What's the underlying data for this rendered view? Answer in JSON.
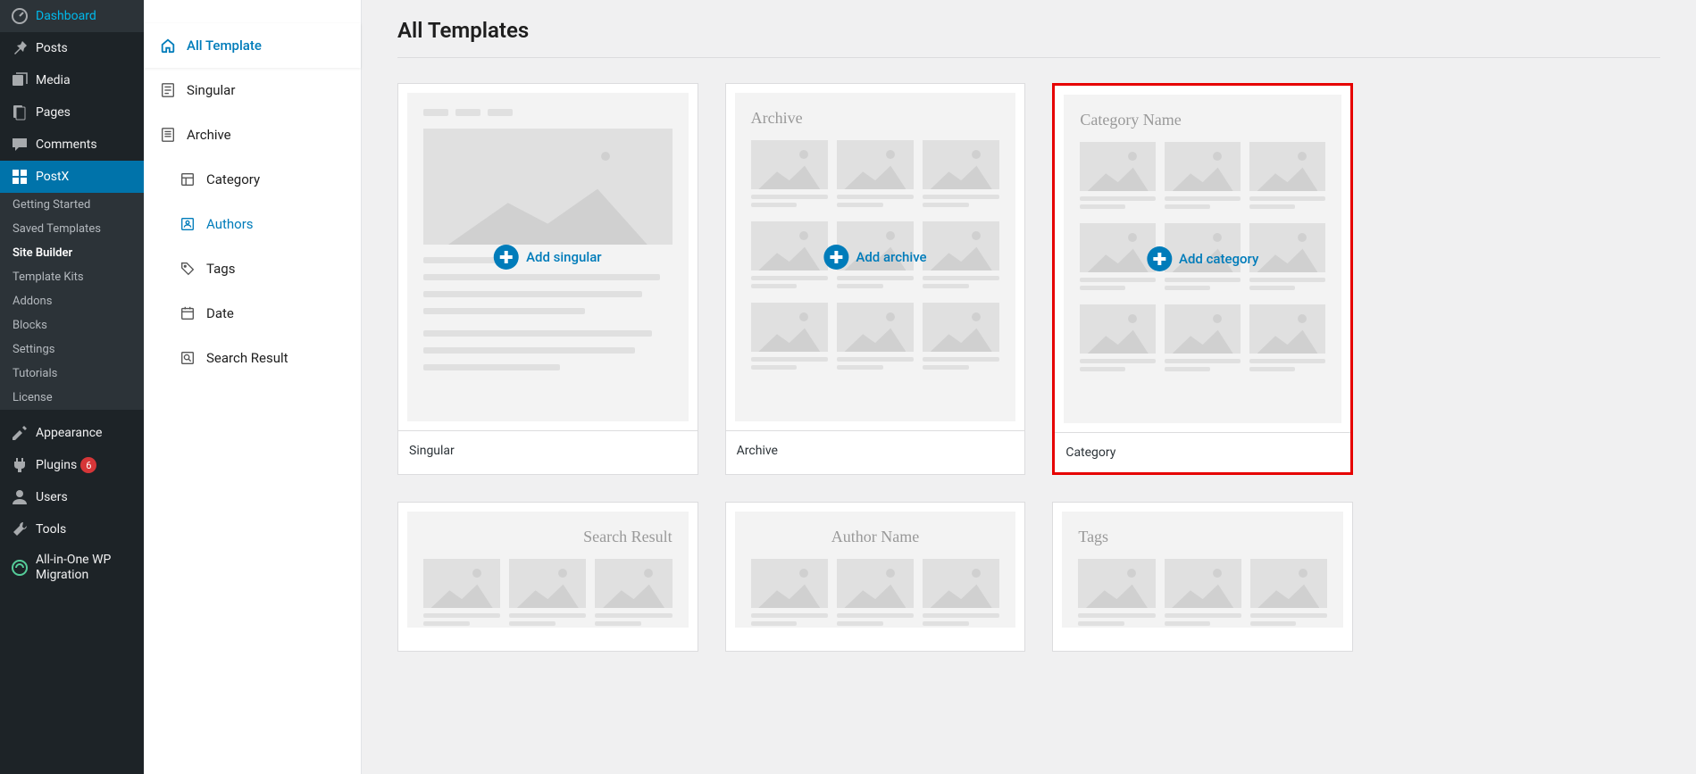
{
  "wp_menu": {
    "dashboard": "Dashboard",
    "posts": "Posts",
    "media": "Media",
    "pages": "Pages",
    "comments": "Comments",
    "postx": "PostX",
    "appearance": "Appearance",
    "plugins": "Plugins",
    "plugins_badge": "6",
    "users": "Users",
    "tools": "Tools",
    "aiowpm": "All-in-One WP Migration"
  },
  "postx_submenu": {
    "getting_started": "Getting Started",
    "saved_templates": "Saved Templates",
    "site_builder": "Site Builder",
    "template_kits": "Template Kits",
    "addons": "Addons",
    "blocks": "Blocks",
    "settings": "Settings",
    "tutorials": "Tutorials",
    "license": "License"
  },
  "inner_sidebar": {
    "all_template": "All Template",
    "singular": "Singular",
    "archive": "Archive",
    "category": "Category",
    "authors": "Authors",
    "tags": "Tags",
    "date": "Date",
    "search_result": "Search Result"
  },
  "page": {
    "title": "All Templates"
  },
  "templates": {
    "singular": {
      "label": "Singular",
      "action": "Add singular"
    },
    "archive": {
      "label": "Archive",
      "action": "Add archive",
      "preview_header": "Archive"
    },
    "category": {
      "label": "Category",
      "action": "Add category",
      "preview_header": "Category Name"
    },
    "search_result": {
      "preview_header": "Search Result"
    },
    "author": {
      "preview_header": "Author Name"
    },
    "tags": {
      "preview_header": "Tags"
    }
  }
}
